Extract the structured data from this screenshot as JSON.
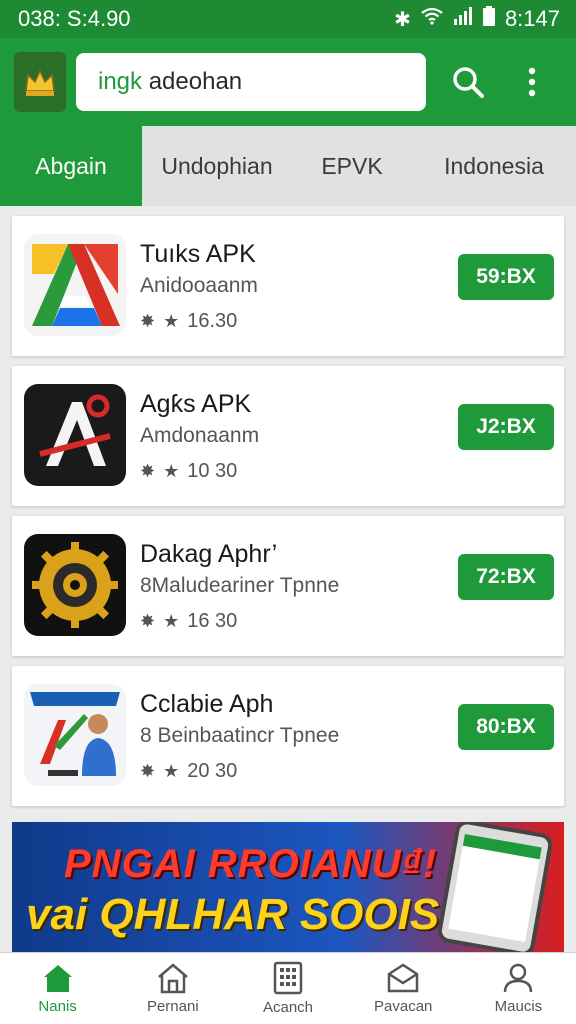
{
  "status": {
    "left": "038: S:4.90",
    "time": "8:147"
  },
  "search": {
    "query_prefix": "ingk",
    "query_rest": "adeohan"
  },
  "tabs": [
    "Abgain",
    "Undophian",
    "EPVK",
    "Indonesia"
  ],
  "apps": [
    {
      "name": "Tuıks APK",
      "sub": "Anidooaanm",
      "rating": "16.30",
      "size": "59:BX",
      "icon": "triangle-a-app-icon"
    },
    {
      "name": "Agƙs APK",
      "sub": "Amdonaanm",
      "rating": "10 30",
      "size": "J2:BX",
      "icon": "red-a-logo-app-icon"
    },
    {
      "name": "Dakag Aphr’",
      "sub": "8Maludeariner Tpnne",
      "rating": "16 30",
      "size": "72:BX",
      "icon": "gear-app-icon"
    },
    {
      "name": "Cclabie Aph",
      "sub": "Beinbaatincr Tpnee",
      "sub_prefix": "8",
      "rating": "20 30",
      "size": "80:BX",
      "icon": "person-promo-app-icon"
    }
  ],
  "banner": {
    "line1": "PNGAI RROIANU₫!",
    "line2": "vai QHLHAR SOOIS"
  },
  "nav": [
    {
      "label": "Nanis",
      "icon": "home-filled-icon"
    },
    {
      "label": "Pernani",
      "icon": "home-outline-icon"
    },
    {
      "label": "Acanch",
      "icon": "grid-icon"
    },
    {
      "label": "Pavacan",
      "icon": "box-icon"
    },
    {
      "label": "Maucis",
      "icon": "person-icon"
    }
  ],
  "colors": {
    "primary": "#1f9a3a",
    "status": "#1f8a34"
  }
}
